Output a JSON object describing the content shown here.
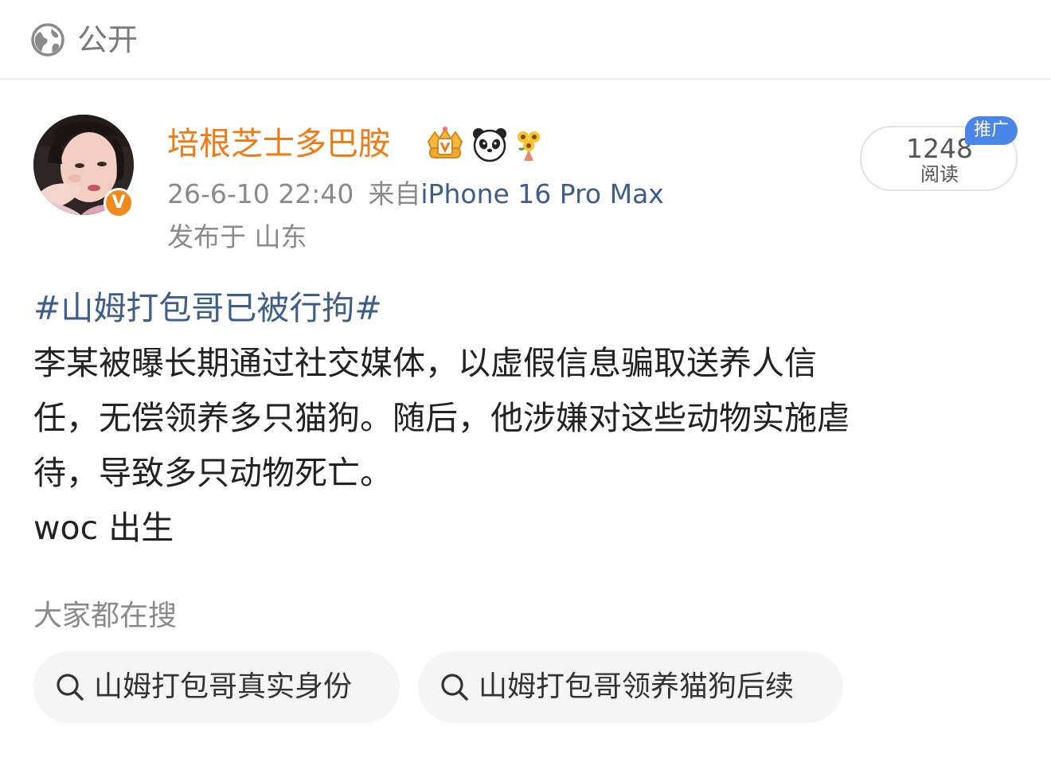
{
  "header": {
    "visibility_icon": "globe-icon",
    "visibility_label": "公开"
  },
  "author": {
    "name": "培根芝士多巴胺",
    "badges": [
      "crown-icon",
      "panda-icon",
      "sunflower-icon"
    ],
    "verified_badge_icon": "verified-v-icon",
    "verified_mark": "V",
    "brand_color": "#f07a14"
  },
  "meta": {
    "timestamp": "26-6-10 22:40",
    "source_prefix": "来自",
    "device": "iPhone 16 Pro Max",
    "location": "发布于 山东"
  },
  "stats": {
    "read_count": "1248",
    "read_label": "阅读",
    "promo_tag": "推广"
  },
  "post": {
    "hashtag": "#山姆打包哥已被行拘#",
    "lines": [
      "李某被曝长期通过社交媒体，以虚假信息骗取送养人信",
      "任，无偿领养多只猫狗。随后，他涉嫌对这些动物实施虐",
      "待，导致多只动物死亡。",
      "woc 出生"
    ]
  },
  "trending": {
    "heading": "大家都在搜",
    "items": [
      {
        "icon": "search-icon",
        "label": "山姆打包哥真实身份"
      },
      {
        "icon": "search-icon",
        "label": "山姆打包哥领养猫狗后续"
      }
    ]
  },
  "colors": {
    "link": "#3d5d8a",
    "muted": "#8a8a8a",
    "promo": "#4a86e8",
    "chip_bg": "#f5f5f5"
  }
}
